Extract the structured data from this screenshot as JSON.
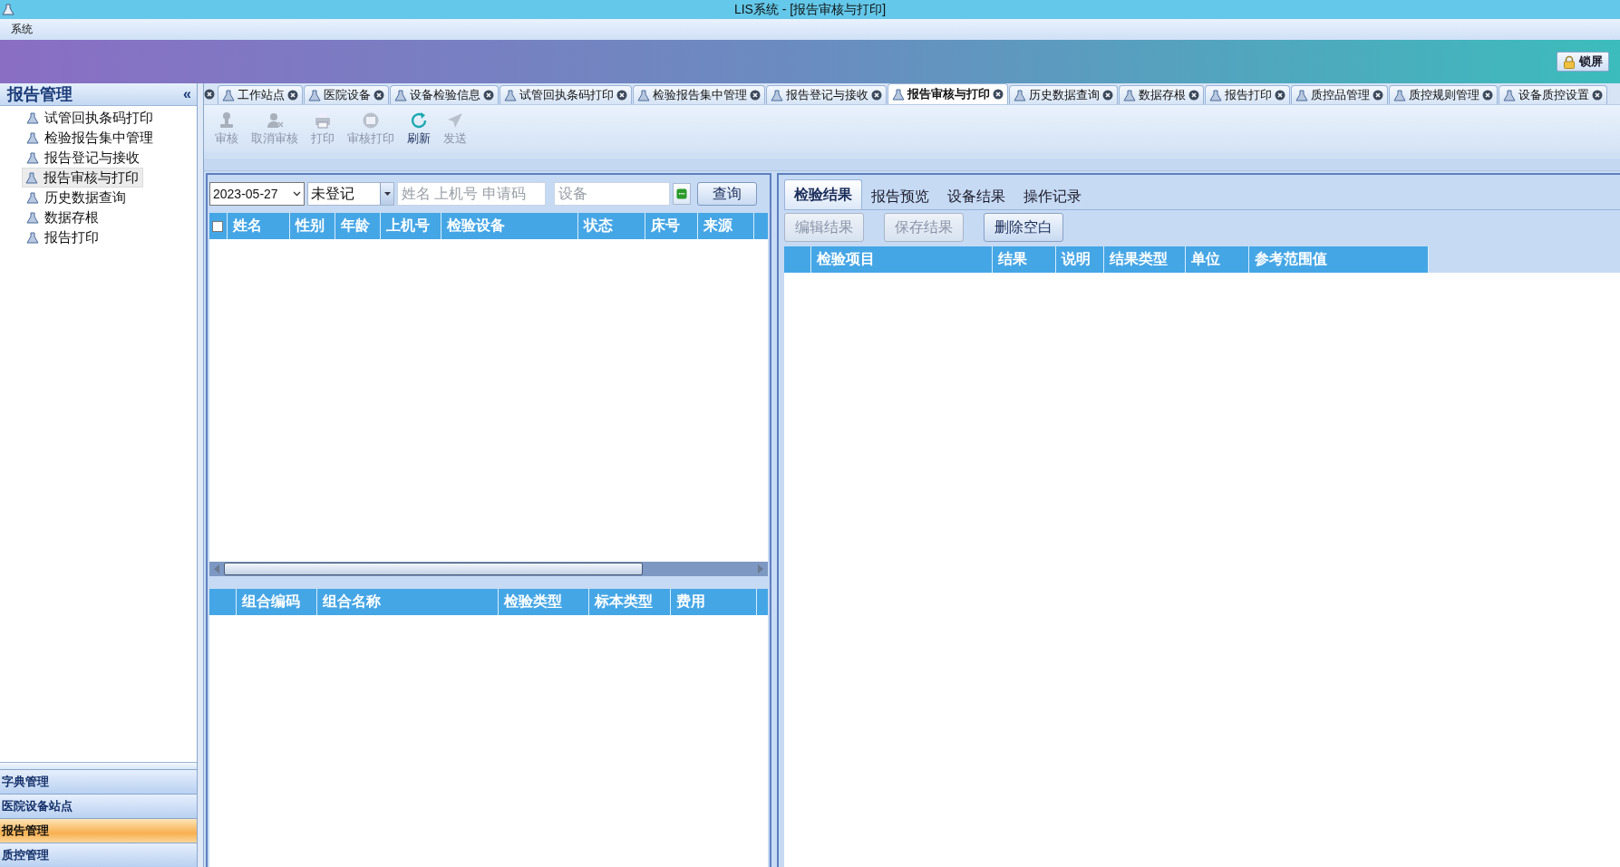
{
  "window": {
    "title": "LIS系统 - [报告审核与打印]"
  },
  "menu": [
    "系统"
  ],
  "lock_button": "锁屏",
  "sidebar": {
    "title": "报告管理",
    "collapse_glyph": "«",
    "items": [
      {
        "label": "试管回执条码打印",
        "selected": false
      },
      {
        "label": "检验报告集中管理",
        "selected": false
      },
      {
        "label": "报告登记与接收",
        "selected": false
      },
      {
        "label": "报告审核与打印",
        "selected": true
      },
      {
        "label": "历史数据查询",
        "selected": false
      },
      {
        "label": "数据存根",
        "selected": false
      },
      {
        "label": "报告打印",
        "selected": false
      }
    ],
    "sections": [
      {
        "label": "字典管理",
        "selected": false
      },
      {
        "label": "医院设备站点",
        "selected": false
      },
      {
        "label": "报告管理",
        "selected": true
      },
      {
        "label": "质控管理",
        "selected": false
      }
    ]
  },
  "tabs": [
    {
      "label": "工作站点",
      "selected": false
    },
    {
      "label": "医院设备",
      "selected": false
    },
    {
      "label": "设备检验信息",
      "selected": false
    },
    {
      "label": "试管回执条码打印",
      "selected": false
    },
    {
      "label": "检验报告集中管理",
      "selected": false
    },
    {
      "label": "报告登记与接收",
      "selected": false
    },
    {
      "label": "报告审核与打印",
      "selected": true
    },
    {
      "label": "历史数据查询",
      "selected": false
    },
    {
      "label": "数据存根",
      "selected": false
    },
    {
      "label": "报告打印",
      "selected": false
    },
    {
      "label": "质控品管理",
      "selected": false
    },
    {
      "label": "质控规则管理",
      "selected": false
    },
    {
      "label": "设备质控设置",
      "selected": false
    }
  ],
  "toolbar": [
    {
      "label": "审核",
      "kind": "stamp",
      "disabled": true
    },
    {
      "label": "取消审核",
      "kind": "user",
      "disabled": true
    },
    {
      "label": "打印",
      "kind": "printer",
      "disabled": true
    },
    {
      "label": "审核打印",
      "kind": "seal",
      "disabled": true
    },
    {
      "label": "刷新",
      "kind": "refresh",
      "disabled": false
    },
    {
      "label": "发送",
      "kind": "send",
      "disabled": true
    }
  ],
  "filter": {
    "date": "2023-05-27",
    "status": "未登记",
    "search_placeholder": "姓名 上机号 申请码",
    "device_placeholder": "设备",
    "query_button": "查询"
  },
  "patient_grid": {
    "all_checked": false,
    "columns": [
      "姓名",
      "性别",
      "年龄",
      "上机号",
      "检验设备",
      "状态",
      "床号",
      "来源"
    ]
  },
  "combo_grid": {
    "columns": [
      "组合编码",
      "组合名称",
      "检验类型",
      "标本类型",
      "费用"
    ]
  },
  "result_tabs": [
    {
      "label": "检验结果",
      "selected": true
    },
    {
      "label": "报告预览",
      "selected": false
    },
    {
      "label": "设备结果",
      "selected": false
    },
    {
      "label": "操作记录",
      "selected": false
    }
  ],
  "result_buttons": [
    {
      "label": "编辑结果",
      "disabled": true
    },
    {
      "label": "保存结果",
      "disabled": true
    },
    {
      "label": "删除空白",
      "disabled": false
    }
  ],
  "result_grid": {
    "columns": [
      "检验项目",
      "结果",
      "说明",
      "结果类型",
      "单位",
      "参考范围值"
    ]
  }
}
